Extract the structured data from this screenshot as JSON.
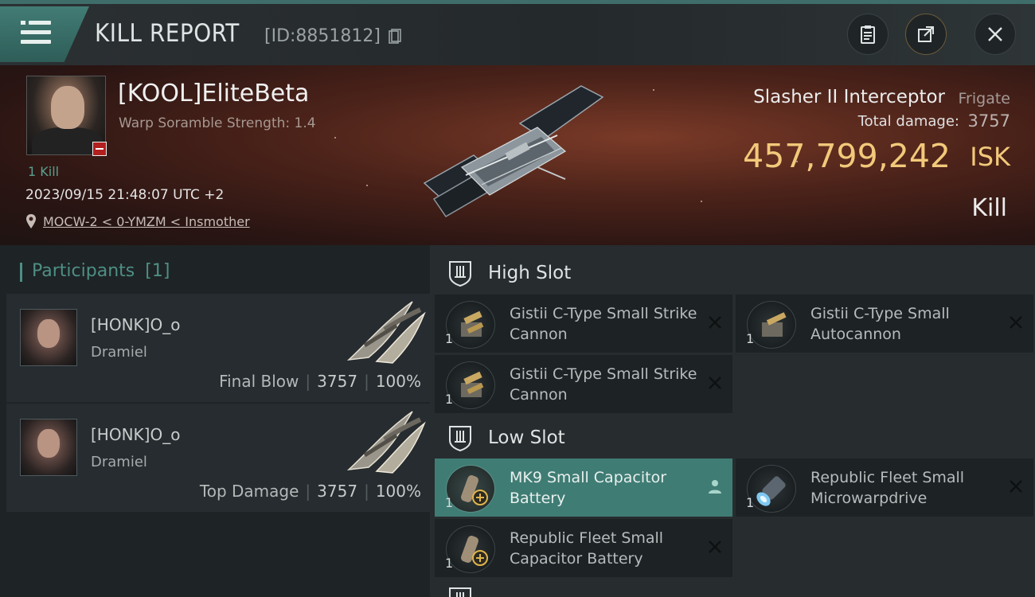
{
  "header": {
    "title": "KILL REPORT",
    "report_id": "[ID:8851812]"
  },
  "victim": {
    "name": "[KOOL]EliteBeta",
    "warp_scramble": "Warp Soramble Strength: 1.4",
    "kills": "1 Kill",
    "datetime": "2023/09/15 21:48:07 UTC +2",
    "location": "MOCW-2 < 0-YMZM < Insmother",
    "ship_name": "Slasher II Interceptor",
    "ship_class": "Frigate",
    "total_damage_label": "Total damage:",
    "total_damage": "3757",
    "isk_value": "457,799,242",
    "isk_unit": "ISK",
    "result": "Kill"
  },
  "participants": {
    "label": "Participants",
    "count": "[1]",
    "rows": [
      {
        "name": "[HONK]O_o",
        "corp": "Dramiel",
        "role": "Final Blow",
        "damage": "3757",
        "percent": "100%"
      },
      {
        "name": "[HONK]O_o",
        "corp": "Dramiel",
        "role": "Top Damage",
        "damage": "3757",
        "percent": "100%"
      }
    ]
  },
  "fitting": {
    "high_slot": {
      "label": "High Slot",
      "modules": [
        {
          "qty": "1",
          "name": "Gistii C-Type Small Strike Cannon",
          "status_icon": "destroyed-x-icon"
        },
        {
          "qty": "1",
          "name": "Gistii C-Type Small Autocannon",
          "status_icon": "destroyed-x-icon"
        },
        {
          "qty": "1",
          "name": "Gistii C-Type Small Strike Cannon",
          "status_icon": "destroyed-x-icon"
        }
      ]
    },
    "low_slot": {
      "label": "Low Slot",
      "modules": [
        {
          "qty": "1",
          "name": "MK9 Small Capacitor Battery",
          "status_icon": "dropped-person-icon",
          "highlighted": true
        },
        {
          "qty": "1",
          "name": "Republic Fleet Small Microwarpdrive",
          "status_icon": "destroyed-x-icon"
        },
        {
          "qty": "1",
          "name": "Republic Fleet Small Capacitor Battery",
          "status_icon": "destroyed-x-icon"
        }
      ]
    }
  },
  "colors": {
    "accent": "#4e8f84",
    "isk": "#f2c97a",
    "highlight": "#3f7c74"
  }
}
